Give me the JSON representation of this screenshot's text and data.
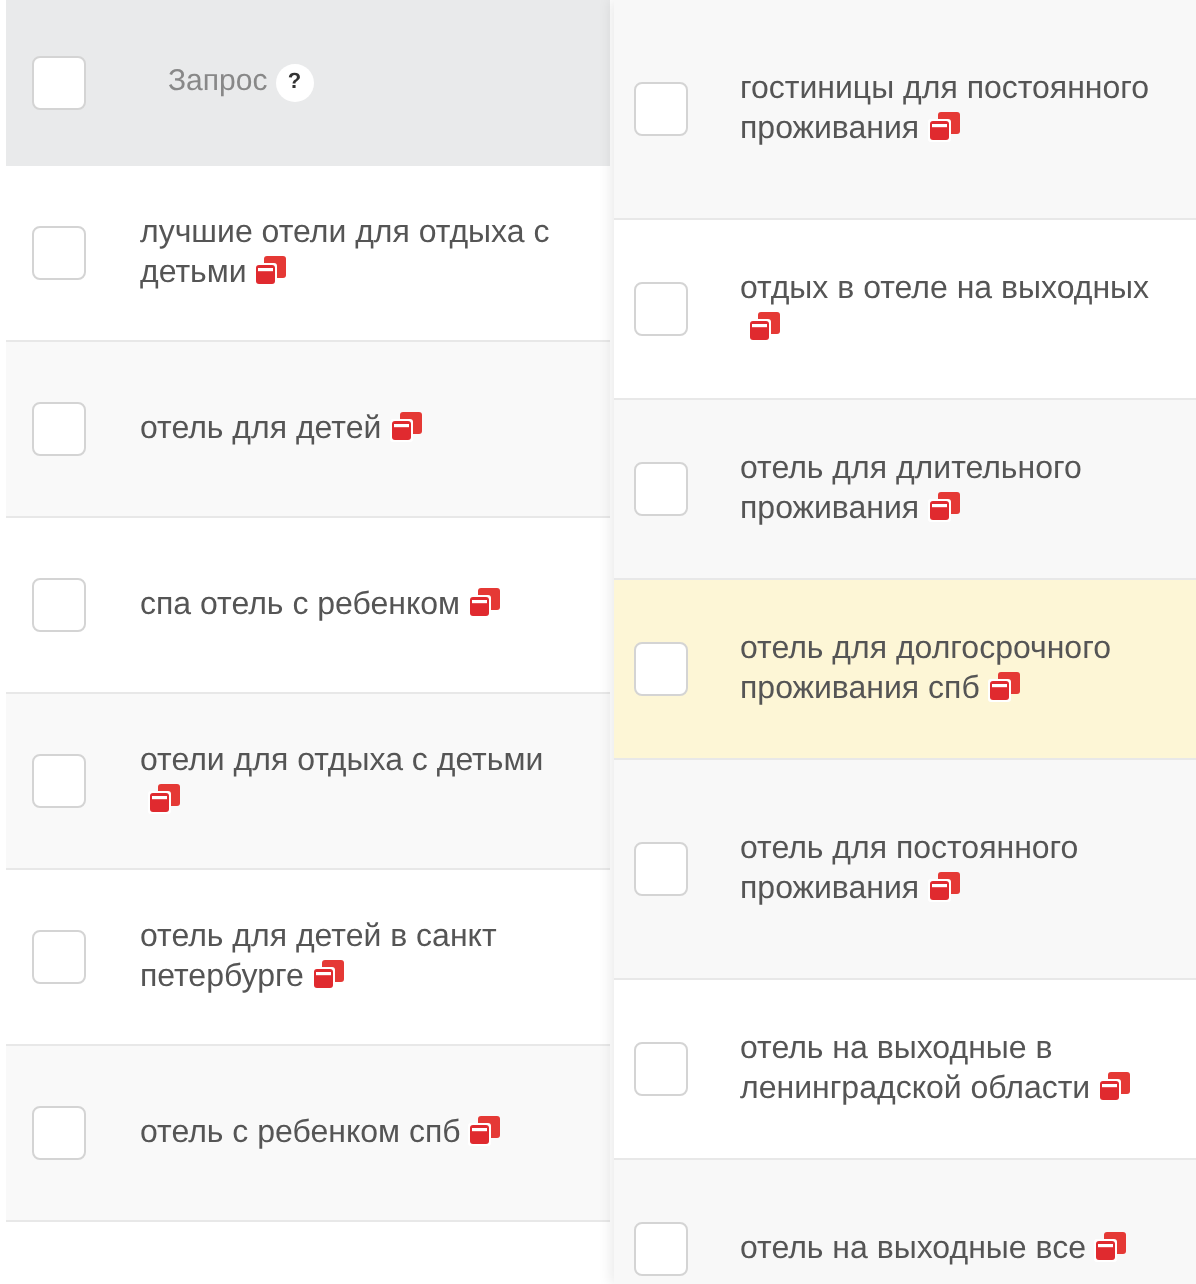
{
  "left_table": {
    "header": {
      "label": "Запрос",
      "help": "?",
      "checked": false
    },
    "rows": [
      {
        "query": "лучшие отели для отдыха с детьми",
        "checked": false
      },
      {
        "query": "отель для детей",
        "checked": false
      },
      {
        "query": "спа отель с ребенком",
        "checked": false
      },
      {
        "query": "отели для отдыха с детьми",
        "checked": false
      },
      {
        "query": "отель для детей в санкт петербурге",
        "checked": false
      },
      {
        "query": "отель с ребенком спб",
        "checked": false
      }
    ]
  },
  "right_table": {
    "rows": [
      {
        "query": "гостиницы для постоянного проживания",
        "checked": false,
        "highlighted": false
      },
      {
        "query": "отдых в отеле на выходных",
        "checked": false,
        "highlighted": false
      },
      {
        "query": "отель для длительного проживания",
        "checked": false,
        "highlighted": false
      },
      {
        "query": "отель для долгосрочного проживания спб",
        "checked": false,
        "highlighted": true
      },
      {
        "query": "отель для постоянного проживания",
        "checked": false,
        "highlighted": false
      },
      {
        "query": "отель на выходные в ленинградской области",
        "checked": false,
        "highlighted": false
      },
      {
        "query": "отель на выходные все",
        "checked": false,
        "highlighted": false
      }
    ]
  }
}
